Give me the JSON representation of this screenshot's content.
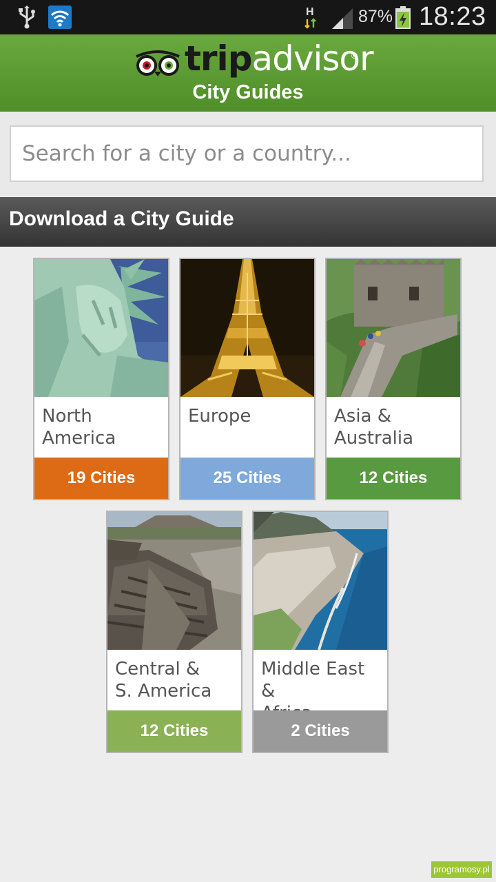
{
  "status_bar": {
    "battery_percent": "87%",
    "time": "18:23",
    "network_type": "H"
  },
  "header": {
    "logo_trip": "trip",
    "logo_advisor": "advisor",
    "title": "City Guides"
  },
  "search": {
    "placeholder": "Search for a city or a country..."
  },
  "section": {
    "title": "Download a City Guide"
  },
  "regions": [
    {
      "name_line1": "North",
      "name_line2": "America",
      "count": "19 Cities",
      "color": "#dd6b15"
    },
    {
      "name_line1": "Europe",
      "name_line2": "",
      "count": "25 Cities",
      "color": "#7fa9da"
    },
    {
      "name_line1": "Asia &",
      "name_line2": "Australia",
      "count": "12 Cities",
      "color": "#589a3f"
    },
    {
      "name_line1": "Central &",
      "name_line2": "S. America",
      "count": "12 Cities",
      "color": "#8ab254"
    },
    {
      "name_line1": "Middle East &",
      "name_line2": "Africa",
      "count": "2 Cities",
      "color": "#9a9a9a"
    }
  ],
  "watermark": "programosy.pl"
}
